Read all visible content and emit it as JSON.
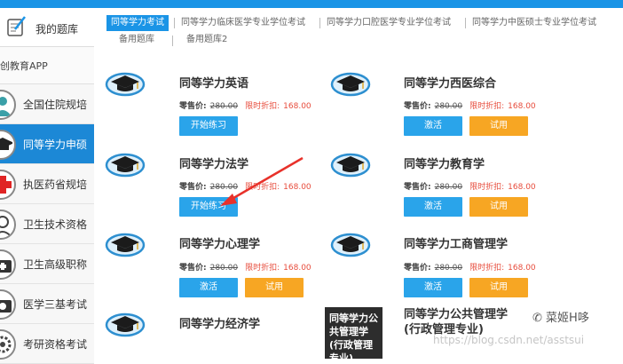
{
  "sidebar": {
    "header": {
      "label": "我的题库"
    },
    "app_label": "创教育APP",
    "items": [
      {
        "label": "全国住院规培",
        "icon": "doctor-icon",
        "active": false
      },
      {
        "label": "同等学力申硕",
        "icon": "graduation-cap-icon",
        "active": true
      },
      {
        "label": "执医药省规培",
        "icon": "red-cross-icon",
        "active": false
      },
      {
        "label": "卫生技术资格",
        "icon": "nurse-icon",
        "active": false
      },
      {
        "label": "卫生高级职称",
        "icon": "medical-kit-icon",
        "active": false
      },
      {
        "label": "医学三基考试",
        "icon": "first-aid-icon",
        "active": false
      },
      {
        "label": "考研资格考试",
        "icon": "gear-icon",
        "active": false
      }
    ]
  },
  "tabs": [
    {
      "label": "同等学力考试",
      "active": true
    },
    {
      "label": "同等学力临床医学专业学位考试",
      "active": false
    },
    {
      "label": "同等学力口腔医学专业学位考试",
      "active": false
    },
    {
      "label": "同等学力中医硕士专业学位考试",
      "active": false
    },
    {
      "label": "备用题库",
      "active": false
    },
    {
      "label": "备用题库2",
      "active": false
    }
  ],
  "price_labels": {
    "retail": "零售价:",
    "discount": "限时折扣:"
  },
  "buttons": {
    "start": "开始练习",
    "activate": "激活",
    "trial": "试用"
  },
  "cards": [
    {
      "title": "同等学力英语",
      "retail": "280.00",
      "discount": "168.00"
    },
    {
      "title": "同等学力西医综合",
      "retail": "280.00",
      "discount": "168.00"
    },
    {
      "title": "同等学力法学",
      "retail": "280.00",
      "discount": "168.00"
    },
    {
      "title": "同等学力教育学",
      "retail": "280.00",
      "discount": "168.00"
    },
    {
      "title": "同等学力心理学",
      "retail": "280.00",
      "discount": "168.00"
    },
    {
      "title": "同等学力工商管理学",
      "retail": "280.00",
      "discount": "168.00"
    },
    {
      "title": "同等学力经济学"
    },
    {
      "title": "同等学力公共管理学(行政管理专业)",
      "cover_text": "同等学力公共管理学(行政管理专业)"
    }
  ],
  "watermark": {
    "brand": "菜姬H哆",
    "url": "https://blog.csdn.net/asstsui"
  },
  "colors": {
    "accent": "#1a94e6",
    "sidebar_active": "#1c88d6",
    "orange": "#f7a623",
    "discount_red": "#e74c3c",
    "arrow_red": "#e8312a"
  }
}
